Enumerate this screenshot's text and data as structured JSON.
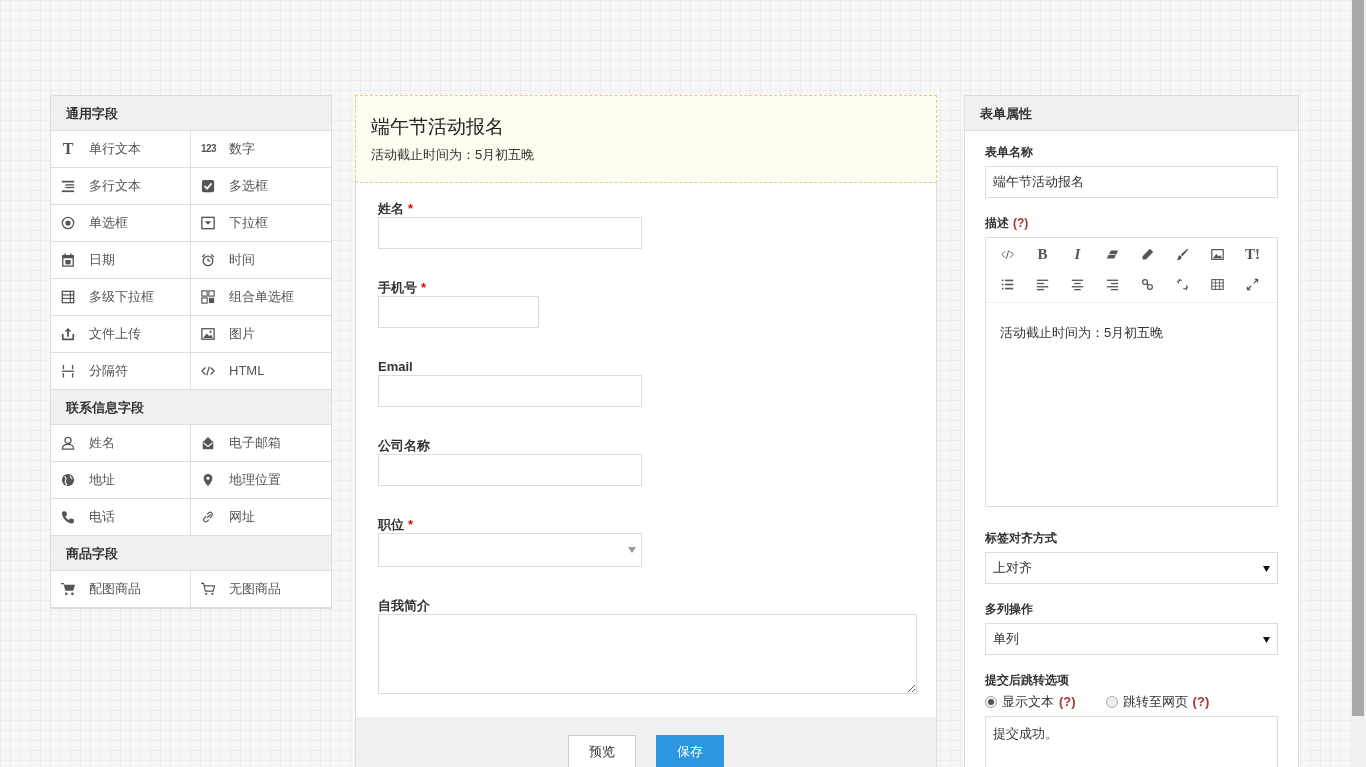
{
  "palette": {
    "groups": [
      {
        "title": "通用字段",
        "items": [
          {
            "label": "单行文本",
            "glyph": "T"
          },
          {
            "label": "数字",
            "glyph": "123"
          },
          {
            "label": "多行文本"
          },
          {
            "label": "多选框"
          },
          {
            "label": "单选框"
          },
          {
            "label": "下拉框"
          },
          {
            "label": "日期"
          },
          {
            "label": "时间"
          },
          {
            "label": "多级下拉框"
          },
          {
            "label": "组合单选框"
          },
          {
            "label": "文件上传"
          },
          {
            "label": "图片"
          },
          {
            "label": "分隔符"
          },
          {
            "label": "HTML"
          }
        ]
      },
      {
        "title": "联系信息字段",
        "items": [
          {
            "label": "姓名"
          },
          {
            "label": "电子邮箱"
          },
          {
            "label": "地址"
          },
          {
            "label": "地理位置"
          },
          {
            "label": "电话"
          },
          {
            "label": "网址"
          }
        ]
      },
      {
        "title": "商品字段",
        "items": [
          {
            "label": "配图商品"
          },
          {
            "label": "无图商品"
          }
        ]
      }
    ]
  },
  "form": {
    "title": "端午节活动报名",
    "description": "活动截止时间为：5月初五晚",
    "fields": [
      {
        "label": "姓名",
        "required_mark": "*",
        "kind": "text"
      },
      {
        "label": "手机号",
        "required_mark": "*",
        "kind": "phone"
      },
      {
        "label": "Email",
        "kind": "text"
      },
      {
        "label": "公司名称",
        "kind": "text"
      },
      {
        "label": "职位",
        "required_mark": "*",
        "kind": "select"
      },
      {
        "label": "自我简介",
        "kind": "textarea"
      }
    ],
    "buttons": [
      {
        "label": "预览",
        "kind": "secondary"
      },
      {
        "label": "保存",
        "kind": "primary"
      }
    ]
  },
  "properties": {
    "title": "表单属性",
    "name_label": "表单名称",
    "name_value": "端午节活动报名",
    "desc_label": "描述",
    "desc_help": "(?)",
    "toolbar": [
      {
        "kind": "icon"
      },
      {
        "kind": "text",
        "glyph": "B"
      },
      {
        "kind": "text",
        "glyph": "I"
      },
      {
        "kind": "icon"
      },
      {
        "kind": "icon"
      },
      {
        "kind": "icon"
      },
      {
        "kind": "icon"
      },
      {
        "kind": "text",
        "glyph": "T!"
      },
      {
        "kind": "icon"
      },
      {
        "kind": "icon"
      },
      {
        "kind": "icon"
      },
      {
        "kind": "icon"
      },
      {
        "kind": "icon"
      },
      {
        "kind": "icon"
      },
      {
        "kind": "icon"
      },
      {
        "kind": "icon"
      }
    ],
    "editor_text": "活动截止时间为：5月初五晚",
    "align_label": "标签对齐方式",
    "align_value": "上对齐",
    "columns_label": "多列操作",
    "columns_value": "单列",
    "redirect_label": "提交后跳转选项",
    "redirect_options": [
      {
        "label": "显示文本",
        "help": "(?)",
        "selected": true
      },
      {
        "label": "跳转至网页",
        "help": "(?)",
        "selected": false
      }
    ],
    "redirect_text": "提交成功。"
  }
}
